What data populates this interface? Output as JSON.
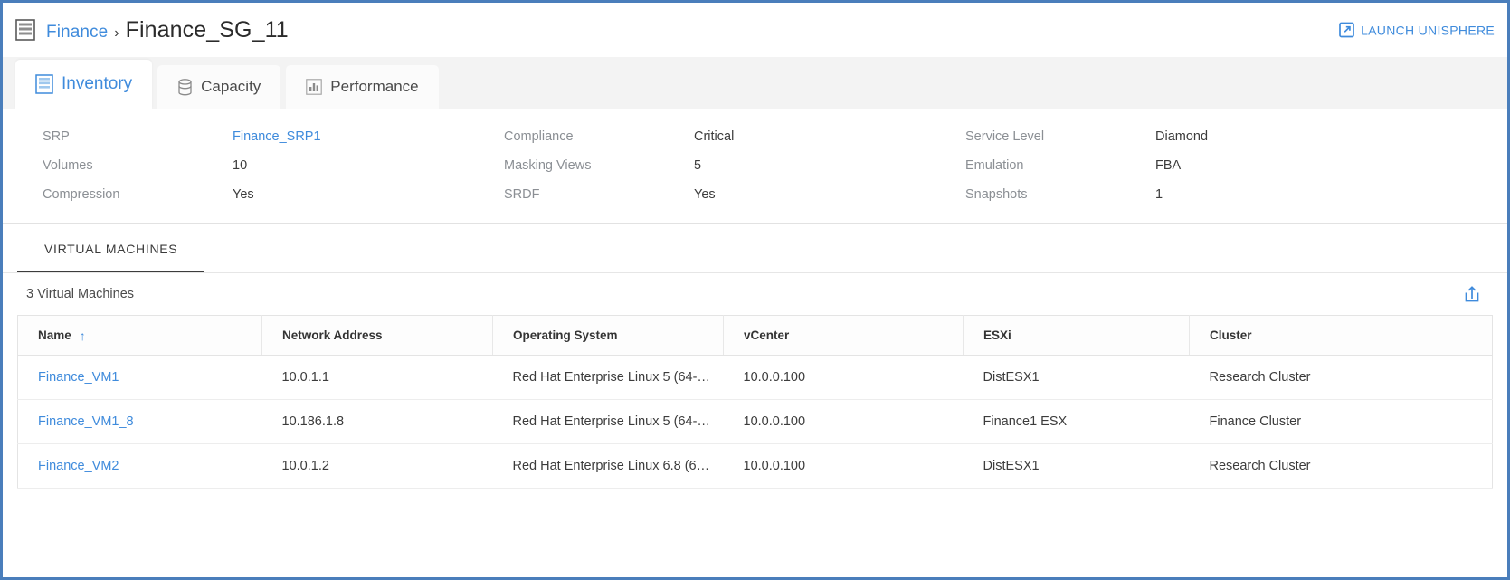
{
  "header": {
    "storage_group_icon": "storage-group-icon",
    "breadcrumb_parent": "Finance",
    "breadcrumb_separator": "›",
    "title": "Finance_SG_11",
    "launch_label": "LAUNCH UNISPHERE",
    "launch_icon": "external-link-icon"
  },
  "tabs": [
    {
      "label": "Inventory",
      "icon": "inventory-icon",
      "active": true
    },
    {
      "label": "Capacity",
      "icon": "database-icon",
      "active": false
    },
    {
      "label": "Performance",
      "icon": "bar-chart-icon",
      "active": false
    }
  ],
  "properties": [
    {
      "label": "SRP",
      "value": "Finance_SRP1",
      "is_link": true
    },
    {
      "label": "Compliance",
      "value": "Critical",
      "is_link": false
    },
    {
      "label": "Service Level",
      "value": "Diamond",
      "is_link": false
    },
    {
      "label": "Volumes",
      "value": "10",
      "is_link": false
    },
    {
      "label": "Masking Views",
      "value": "5",
      "is_link": false
    },
    {
      "label": "Emulation",
      "value": "FBA",
      "is_link": false
    },
    {
      "label": "Compression",
      "value": "Yes",
      "is_link": false
    },
    {
      "label": "SRDF",
      "value": "Yes",
      "is_link": false
    },
    {
      "label": "Snapshots",
      "value": "1",
      "is_link": false
    }
  ],
  "subtabs": [
    {
      "label": "VIRTUAL MACHINES",
      "active": true
    }
  ],
  "table": {
    "count_label": "3 Virtual Machines",
    "export_icon": "export-icon",
    "sort_column": "Name",
    "sort_direction_icon": "↑",
    "columns": [
      "Name",
      "Network Address",
      "Operating System",
      "vCenter",
      "ESXi",
      "Cluster"
    ],
    "rows": [
      {
        "name": "Finance_VM1",
        "network_address": "10.0.1.1",
        "operating_system": "Red Hat Enterprise Linux 5 (64-…",
        "vcenter": "10.0.0.100",
        "esxi": "DistESX1",
        "cluster": "Research Cluster"
      },
      {
        "name": "Finance_VM1_8",
        "network_address": "10.186.1.8",
        "operating_system": "Red Hat Enterprise Linux 5 (64-…",
        "vcenter": "10.0.0.100",
        "esxi": "Finance1 ESX",
        "cluster": "Finance Cluster"
      },
      {
        "name": "Finance_VM2",
        "network_address": "10.0.1.2",
        "operating_system": "Red Hat Enterprise Linux 6.8 (6…",
        "vcenter": "10.0.0.100",
        "esxi": "DistESX1",
        "cluster": "Research Cluster"
      }
    ]
  },
  "colors": {
    "accent": "#3f8bdc",
    "window_border": "#4a7ebb",
    "tabstrip_bg": "#f3f3f3",
    "label_gray": "#8b8f94",
    "text_dark": "#3c3c3c"
  }
}
